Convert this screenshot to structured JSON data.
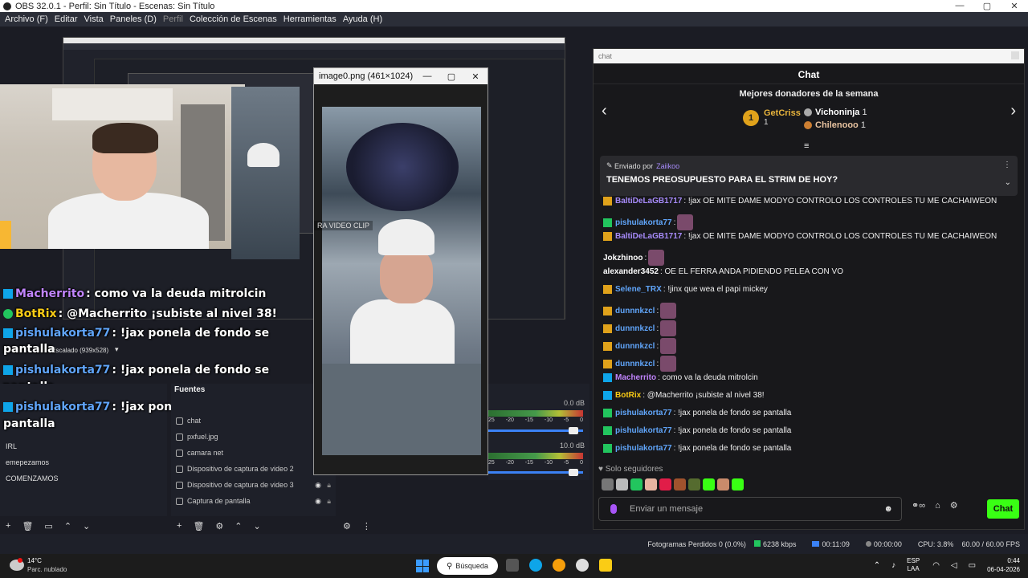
{
  "titlebar": {
    "title": "OBS 32.0.1 - Perfil: Sin Título - Escenas: Sin Título",
    "minimize": "—",
    "maximize": "▢",
    "close": "✕"
  },
  "menubar": {
    "items": [
      "Archivo (F)",
      "Editar",
      "Vista",
      "Paneles (D)",
      "Perfil",
      "Colección de Escenas",
      "Herramientas",
      "Ayuda (H)"
    ]
  },
  "viewer": {
    "title": "image0.png (461×1024)",
    "min": "—",
    "max": "▢",
    "close": "✕",
    "overlay_label": "RA VIDEO CLIP"
  },
  "overlay_chat": [
    {
      "user": "Macherrito",
      "text": ": como va la deuda mitrolcin"
    },
    {
      "user": "BotRix",
      "text": ": @Macherrito ¡subiste al nivel 38!"
    },
    {
      "user": "pishulakorta77",
      "text": ": !jax ponela de fondo se"
    },
    {
      "user": "",
      "text": "pantalla"
    },
    {
      "user": "pishulakorta77",
      "text": ": !jax ponela de fondo se"
    },
    {
      "user": "",
      "text": "pantalla"
    },
    {
      "user": "pishulakorta77",
      "text": ": !jax ponela de fondo se"
    },
    {
      "user": "",
      "text": "pantalla"
    }
  ],
  "scaling_label": "Escalado (939x528)",
  "scenes": {
    "header": "",
    "items": [
      "IRL",
      "emepezamos",
      "COMENZAMOS"
    ]
  },
  "sources": {
    "header": "Fuentes",
    "items": [
      {
        "label": "chat",
        "visible": true,
        "locked": false
      },
      {
        "label": "pxfuel.jpg",
        "visible": true,
        "locked": false
      },
      {
        "label": "camara net",
        "visible": true,
        "locked": false
      },
      {
        "label": "Dispositivo de captura de video 2",
        "visible": true,
        "locked": false
      },
      {
        "label": "Dispositivo de captura de video 3",
        "visible": true,
        "locked": true
      },
      {
        "label": "Captura de pantalla",
        "visible": true,
        "locked": true
      }
    ]
  },
  "mixer": {
    "db1": "0.0 dB",
    "db2": "10.0 dB",
    "scale": [
      "25",
      "-20",
      "-15",
      "-10",
      "-5",
      "0"
    ]
  },
  "chat": {
    "address": "chat",
    "header": "Chat",
    "donors_title": "Mejores donadores de la semana",
    "donor1": {
      "rank": "1",
      "name": "GetCriss",
      "count": "1"
    },
    "donor2": {
      "name": "Vichoninja",
      "count": "1"
    },
    "donor3": {
      "name": "Chilenooo",
      "count": "1"
    },
    "pinned": {
      "by_label": "Enviado por",
      "user": "Zaiikoo",
      "text": "TENEMOS PREOSUPUESTO PARA EL STRIM DE HOY?"
    },
    "messages": [
      {
        "user": "BaltiDeLaGB1717",
        "text": ": !jax OE MITE DAME MODYO CONTROLO LOS CONTROLES TU ME CACHAIWEON",
        "color": "#a78bfa",
        "badge": "gold"
      },
      {
        "user": "pishulakorta77",
        "text": ":",
        "color": "#60a5fa",
        "badge": "green"
      },
      {
        "user": "BaltiDeLaGB1717",
        "text": ": !jax OE MITE DAME MODYO CONTROLO LOS CONTROLES TU ME CACHAIWEON",
        "color": "#a78bfa",
        "badge": "gold"
      },
      {
        "user": "Jokzhinoo",
        "text": ":",
        "color": "#ffffff",
        "badge": "none"
      },
      {
        "user": "alexander3452",
        "text": ": OE EL FERRA ANDA PIDIENDO PELEA CON VO",
        "color": "#ffffff",
        "badge": "none"
      },
      {
        "user": "Selene_TRX",
        "text": ": !jinx que wea el papi mickey",
        "color": "#60a5fa",
        "badge": "gold"
      },
      {
        "user": "dunnnkzcl",
        "text": ":",
        "color": "#60a5fa",
        "badge": "gold"
      },
      {
        "user": "dunnnkzcl",
        "text": ":",
        "color": "#60a5fa",
        "badge": "gold"
      },
      {
        "user": "dunnnkzcl",
        "text": ":",
        "color": "#60a5fa",
        "badge": "gold"
      },
      {
        "user": "dunnnkzcl",
        "text": ":",
        "color": "#60a5fa",
        "badge": "gold"
      },
      {
        "user": "Macherrito",
        "text": ": como va la deuda mitrolcin",
        "color": "#c084fc",
        "badge": "blue"
      },
      {
        "user": "BotRix",
        "text": ": @Macherrito ¡subiste al nivel 38!",
        "color": "#facc15",
        "badge": "blue"
      },
      {
        "user": "pishulakorta77",
        "text": ": !jax ponela de fondo se pantalla",
        "color": "#60a5fa",
        "badge": "green"
      },
      {
        "user": "pishulakorta77",
        "text": ": !jax ponela de fondo se pantalla",
        "color": "#60a5fa",
        "badge": "green"
      },
      {
        "user": "pishulakorta77",
        "text": ": !jax ponela de fondo se pantalla",
        "color": "#60a5fa",
        "badge": "green"
      }
    ],
    "followers_only": "Solo seguidores",
    "input_placeholder": "Enviar un mensaje",
    "send_label": "Chat"
  },
  "status": {
    "dropped": "Fotogramas Perdidos 0 (0.0%)",
    "bitrate": "6238 kbps",
    "live_time": "00:11:09",
    "rec_time": "00:00:00",
    "cpu": "CPU: 3.8%",
    "fps": "60.00 / 60.00 FPS"
  },
  "taskbar": {
    "temp": "14°C",
    "weather": "Parc. nublado",
    "search": "Búsqueda",
    "lang1": "ESP",
    "lang2": "LAA",
    "time": "0:44",
    "date": "06-04-2026"
  },
  "colors": {
    "accent_green": "#39ff14",
    "obs_bg": "#1e2029",
    "chat_bg": "#18181b"
  }
}
